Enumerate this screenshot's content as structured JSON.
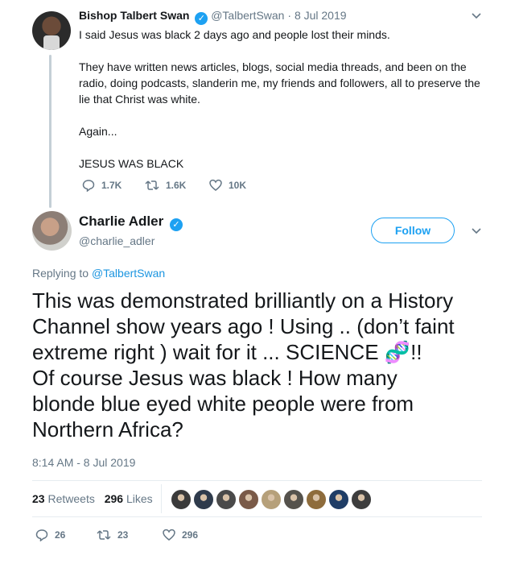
{
  "parent_tweet": {
    "author_name": "Bishop Talbert Swan",
    "handle": "@TalbertSwan",
    "date_separator": "·",
    "date": "8 Jul 2019",
    "paragraphs": [
      "I said Jesus was black 2 days ago and people lost their minds.",
      "They have written news articles, blogs, social media threads, and been on the radio, doing podcasts, slanderin me, my friends and followers, all to preserve the lie that Christ was white.",
      "Again...",
      "JESUS WAS BLACK"
    ],
    "replies": "1.7K",
    "retweets": "1.6K",
    "likes": "10K"
  },
  "main_tweet": {
    "author_name": "Charlie Adler",
    "handle": "@charlie_adler",
    "follow_label": "Follow",
    "replying_prefix": "Replying to ",
    "replying_handle": "@TalbertSwan",
    "text_lines": [
      "This was demonstrated brilliantly on a History",
      "Channel show years ago ! Using .. (don’t faint",
      "extreme right ) wait for it ... SCIENCE ",
      "Of course Jesus was black ! How many",
      "blonde blue eyed white people were from",
      "Northern Africa?"
    ],
    "science_emoji": "🧬",
    "science_suffix": "!!",
    "timestamp": "8:14 AM - 8 Jul 2019",
    "retweets_count": "23",
    "retweets_label": "Retweets",
    "likes_count": "296",
    "likes_label": "Likes",
    "reply_count": "26",
    "retweet_count_action": "23",
    "like_count_action": "296"
  },
  "liker_colors": [
    "#3a3a3a",
    "#2f3b4c",
    "#4a4a4a",
    "#7a5a48",
    "#b6a07a",
    "#55524c",
    "#8e6c3c",
    "#1f3d66",
    "#3d3d3d"
  ]
}
